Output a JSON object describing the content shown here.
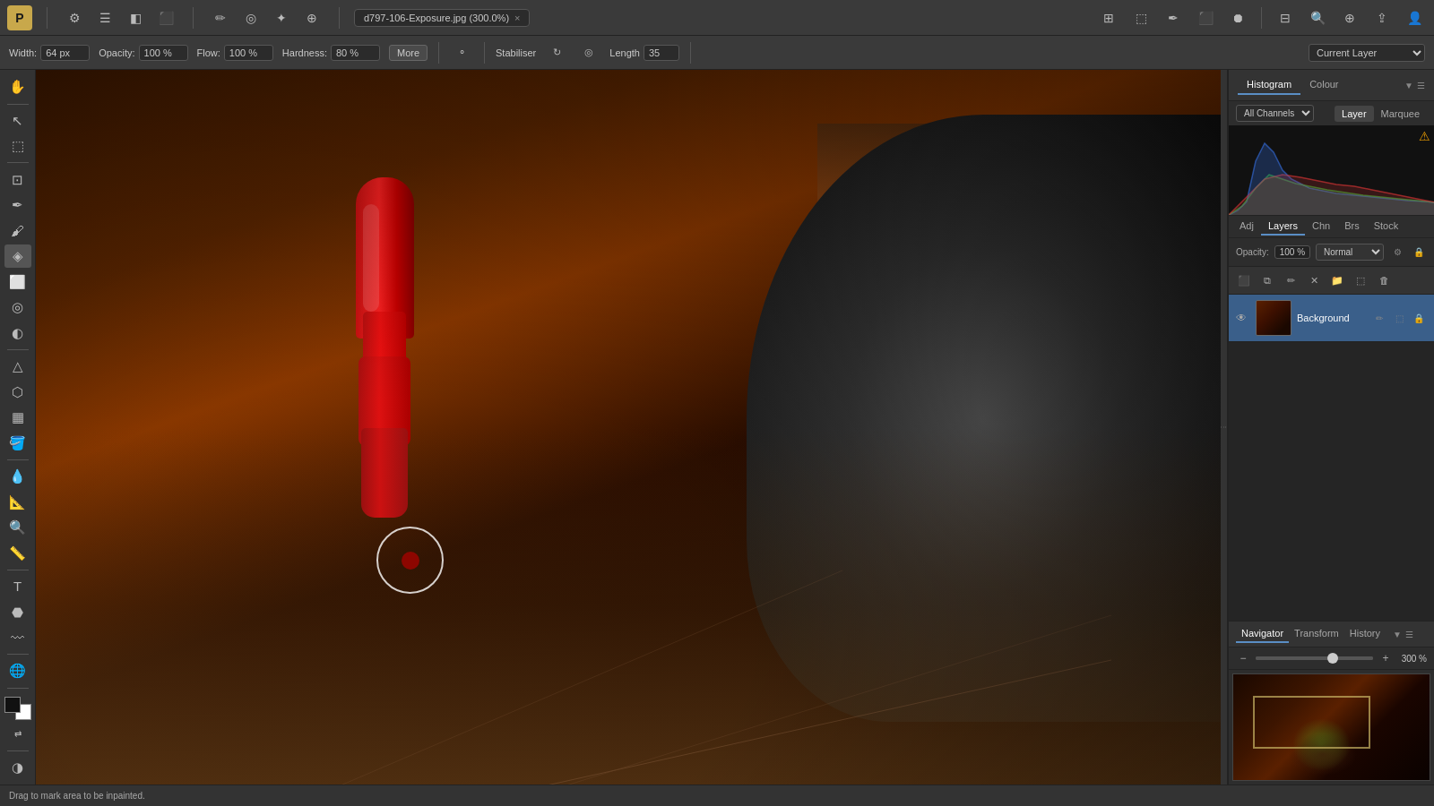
{
  "app": {
    "logo": "P",
    "file_tab": {
      "name": "d797-106-Exposure.jpg (300.0%)",
      "close": "×"
    }
  },
  "menu_icons": [
    "⚙",
    "≡",
    "▤",
    "⬛",
    "✏",
    "⚬",
    "◈",
    "⊕"
  ],
  "toolbar": {
    "width_label": "Width:",
    "width_value": "64 px",
    "opacity_label": "Opacity:",
    "opacity_value": "100 %",
    "flow_label": "Flow:",
    "flow_value": "100 %",
    "hardness_label": "Hardness:",
    "hardness_value": "80 %",
    "more_label": "More",
    "stabiliser_label": "Stabiliser",
    "length_label": "Length",
    "length_value": "35",
    "current_layer_label": "Current Layer"
  },
  "tools": [
    {
      "id": "move",
      "icon": "↖",
      "title": "Move"
    },
    {
      "id": "select-rect",
      "icon": "⬚",
      "title": "Rectangle Select"
    },
    {
      "id": "pen",
      "icon": "✒",
      "title": "Pen"
    },
    {
      "id": "brush",
      "icon": "🖌",
      "title": "Brush"
    },
    {
      "id": "stamp",
      "icon": "◎",
      "title": "Clone Stamp"
    },
    {
      "id": "eraser",
      "icon": "⬜",
      "title": "Eraser"
    },
    {
      "id": "gradient",
      "icon": "▦",
      "title": "Gradient"
    },
    {
      "id": "dodge",
      "icon": "◐",
      "title": "Dodge"
    },
    {
      "id": "path",
      "icon": "⬡",
      "title": "Path"
    },
    {
      "id": "shape",
      "icon": "△",
      "title": "Shape"
    },
    {
      "id": "text",
      "icon": "T",
      "title": "Text"
    },
    {
      "id": "mask",
      "icon": "⬣",
      "title": "Mask"
    },
    {
      "id": "zoom-in",
      "icon": "🔍",
      "title": "Zoom"
    },
    {
      "id": "measure",
      "icon": "📐",
      "title": "Measure"
    },
    {
      "id": "ruler",
      "icon": "📏",
      "title": "Ruler"
    },
    {
      "id": "eyedrop",
      "icon": "💧",
      "title": "Eyedropper"
    },
    {
      "id": "paint",
      "icon": "🪣",
      "title": "Paint Bucket"
    },
    {
      "id": "heal",
      "icon": "✚",
      "title": "Heal"
    },
    {
      "id": "smudge",
      "icon": "〰",
      "title": "Smudge"
    },
    {
      "id": "hand",
      "icon": "✋",
      "title": "Hand"
    }
  ],
  "right_panel": {
    "histogram_tab": "Histogram",
    "colour_tab": "Colour",
    "all_channels": "All Channels",
    "layer_tab": "Layer",
    "marquee_tab": "Marquee",
    "warning_icon": "⚠",
    "adj_tab": "Adj",
    "layers_tab": "Layers",
    "chn_tab": "Chn",
    "brs_tab": "Brs",
    "stock_tab": "Stock"
  },
  "layers_panel": {
    "title": "Layers",
    "opacity_label": "Opacity:",
    "opacity_value": "100 %",
    "blend_mode": "Normal",
    "background_layer": "Background",
    "icons": [
      "⚙",
      "🗑",
      "✚",
      "⬛",
      "📁"
    ]
  },
  "navigator": {
    "navigator_tab": "Navigator",
    "transform_tab": "Transform",
    "history_tab": "History",
    "zoom_value": "300 %",
    "zoom_minus": "−",
    "zoom_plus": "+"
  },
  "status_bar": {
    "message": "Drag to mark area to be inpainted."
  },
  "colors": {
    "active_tool_bg": "#555",
    "panel_bg": "#2d2d2d",
    "toolbar_bg": "#3a3a3a",
    "accent": "#5a8ec5",
    "layer_selected_bg": "#3a5f8a",
    "histogram_bg": "#111"
  }
}
